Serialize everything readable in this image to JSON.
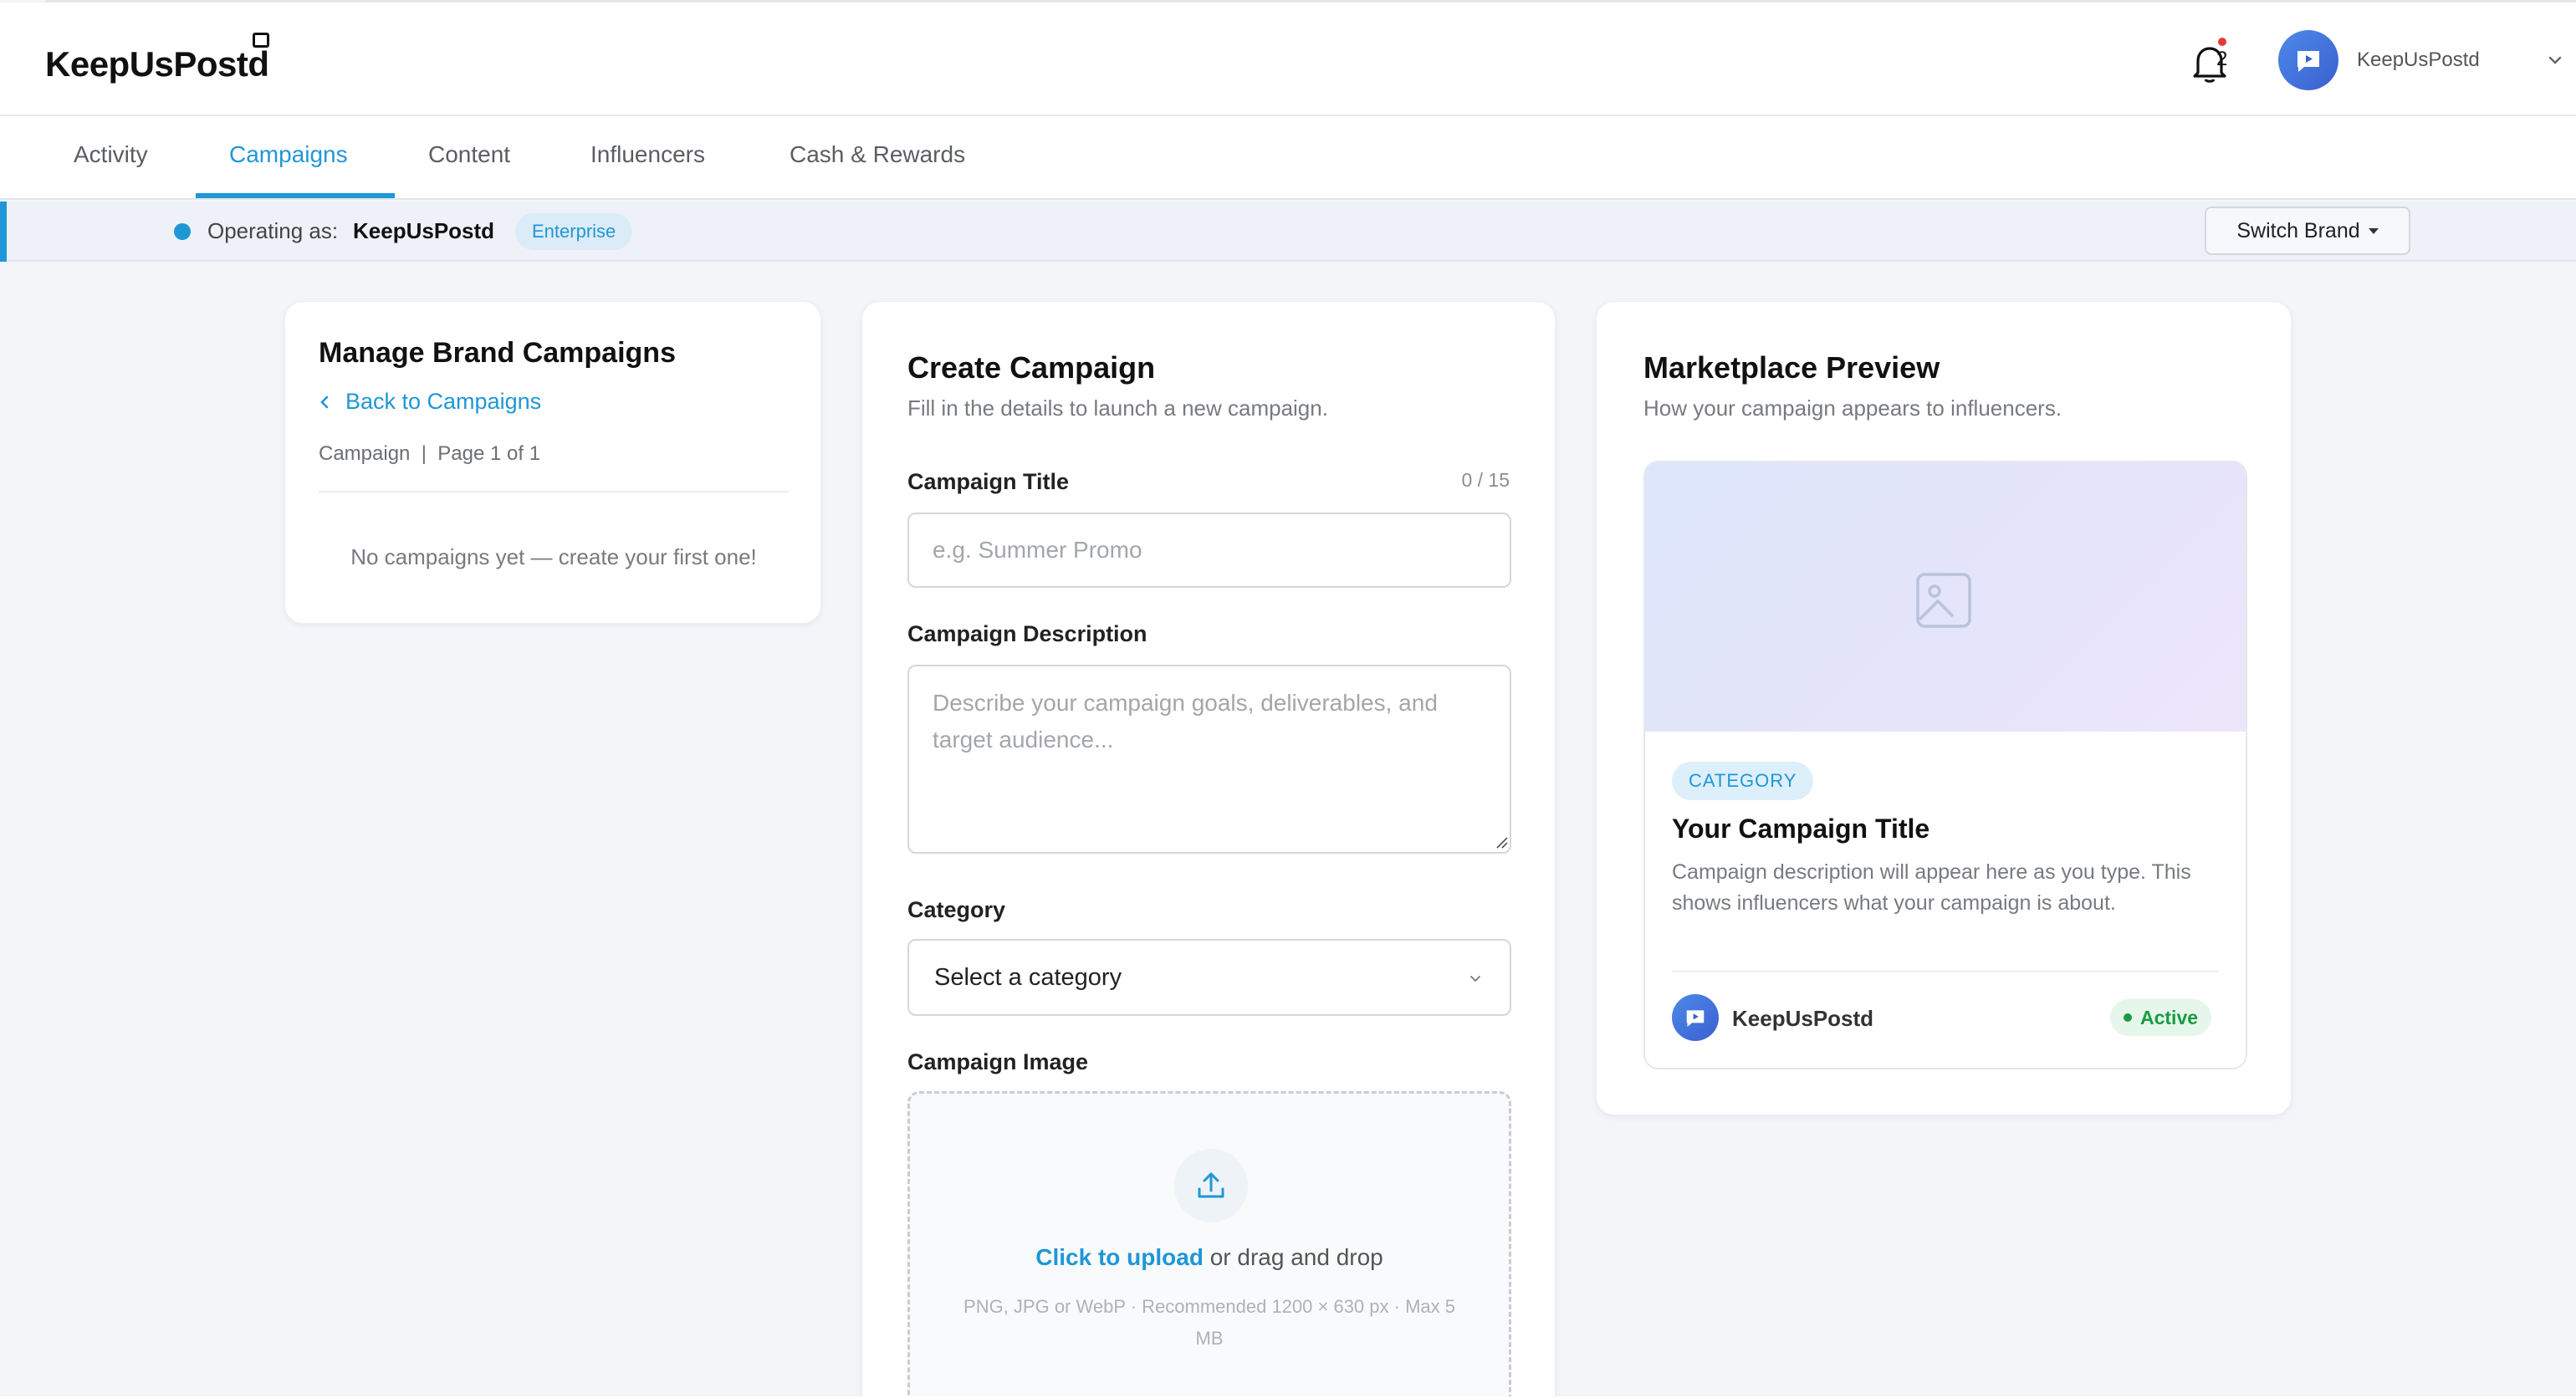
{
  "app": {
    "logo": "KeepUsPostd"
  },
  "header": {
    "notification_count": "2",
    "user_name": "KeepUsPostd",
    "icons": [
      "bell-icon",
      "chevron-down-icon",
      "avatar-chat-icon"
    ]
  },
  "tabs": [
    {
      "label": "Activity",
      "active": false
    },
    {
      "label": "Campaigns",
      "active": true
    },
    {
      "label": "Content",
      "active": false
    },
    {
      "label": "Influencers",
      "active": false
    },
    {
      "label": "Cash & Rewards",
      "active": false
    }
  ],
  "operating_bar": {
    "prefix": "Operating as:",
    "brand": "KeepUsPostd",
    "plan_badge": "Enterprise",
    "switch_label": "Switch Brand"
  },
  "manage": {
    "title": "Manage Brand Campaigns",
    "back_label": "Back to Campaigns",
    "meta": "Campaign  |  Page 1 of 1",
    "empty_text": "No campaigns yet — create your first one!"
  },
  "create": {
    "title": "Create Campaign",
    "subtitle": "Fill in the details to launch a new campaign.",
    "title_label": "Campaign Title",
    "title_counter": "0 / 15",
    "title_placeholder": "e.g. Summer Promo",
    "title_value": "",
    "desc_label": "Campaign Description",
    "desc_placeholder": "Describe your campaign goals, deliverables, and target audience...",
    "desc_value": "",
    "category_label": "Category",
    "category_value": "Select a category",
    "image_label": "Campaign Image",
    "upload_link": "Click to upload",
    "upload_rest": " or drag and drop",
    "upload_hint": "PNG, JPG or WebP · Recommended 1200 × 630 px · Max 5 MB"
  },
  "preview": {
    "title": "Marketplace Preview",
    "subtitle": "How your campaign appears to influencers.",
    "category_badge": "CATEGORY",
    "campaign_title": "Your Campaign Title",
    "campaign_desc": "Campaign description will appear here as you type. This shows influencers what your campaign is about.",
    "brand": "KeepUsPostd",
    "status": "Active"
  },
  "colors": {
    "accent": "#1f97d6",
    "active_green": "#1a9a44",
    "background": "#f3f5f9"
  }
}
